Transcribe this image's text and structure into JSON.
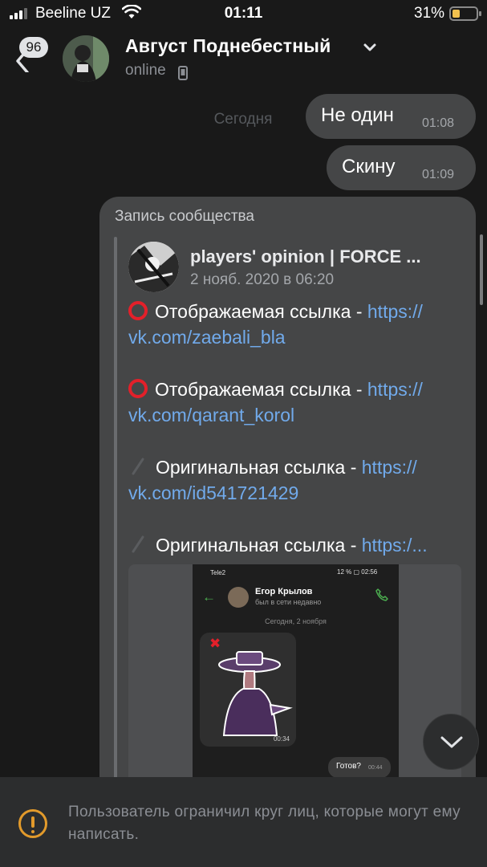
{
  "status_bar": {
    "carrier": "Beeline UZ",
    "time": "01:11",
    "battery": "31%",
    "battery_level": 0.31
  },
  "header": {
    "unread_count": "96",
    "contact_name": "Август Поднебестный",
    "contact_status": "online"
  },
  "chat": {
    "date_separator": "Сегодня",
    "messages": [
      {
        "text": "Не один",
        "time": "01:08"
      },
      {
        "text": "Скину",
        "time": "01:09"
      }
    ],
    "post": {
      "label": "Запись сообщества",
      "community_name": "players' opinion | FORCE ...",
      "date": "2 нояб. 2020 в 06:20",
      "lines": [
        {
          "text": "Отображаемая ссылка - ",
          "link": "https://"
        },
        {
          "text": "",
          "link": "vk.com/zaebali_bla"
        },
        {
          "text": "Отображаемая ссылка - ",
          "link": "https://"
        },
        {
          "text": "",
          "link": "vk.com/qarant_korol"
        },
        {
          "text": "Оригинальная ссылка - ",
          "link": "https://"
        },
        {
          "text": "",
          "link": "vk.com/id541721429"
        },
        {
          "text": "Оригинальная ссылка - ",
          "link": "https:/..."
        }
      ],
      "embedded_screenshot": {
        "carrier": "Tele2",
        "status_right": "12 % ▢ 02:56",
        "contact_name": "Егор Крылов",
        "contact_status": "был в сети недавно",
        "date": "Сегодня, 2 ноября",
        "sticker_time": "00:34",
        "message_text": "Готов?",
        "message_time": "00:44"
      }
    }
  },
  "restriction": {
    "text": "Пользователь ограничил круг лиц, которые могут ему написать."
  }
}
